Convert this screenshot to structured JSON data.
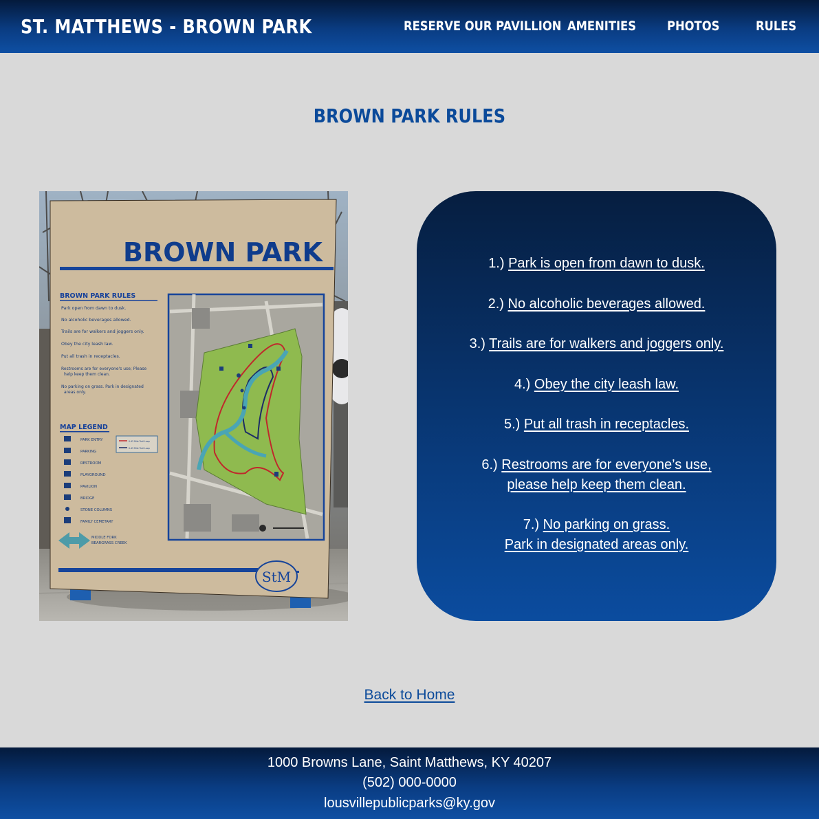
{
  "header": {
    "site_title": "ST. MATTHEWS - BROWN PARK",
    "nav": [
      {
        "label": "RESERVE OUR PAVILLION"
      },
      {
        "label": "AMENITIES"
      },
      {
        "label": "PHOTOS"
      },
      {
        "label": "RULES"
      }
    ]
  },
  "main": {
    "page_title": "BROWN PARK RULES",
    "sign": {
      "title": "BROWN PARK",
      "rules_heading": "BROWN PARK RULES",
      "rules": [
        "Park open from dawn to dusk.",
        "No alcoholic beverages allowed.",
        "Trails are for walkers and joggers only.",
        "Obey the city leash law.",
        "Put all trash in receptacles.",
        "Restrooms are for everyone's use; Please help keep them clean.",
        "No parking on grass. Park in designated areas only."
      ],
      "legend_heading": "MAP LEGEND",
      "legend": [
        "PARK ENTRY",
        "PARKING",
        "RESTROOM",
        "PLAYGROUND",
        "PAVILION",
        "BRIDGE",
        "STONE COLUMNS",
        "FAMILY CEMETARY"
      ],
      "creek_label": "MIDDLE FORK BEARGRASS CREEK",
      "trail_labels": [
        "0.42 Mile Trail Loop",
        "0.45 Mile Trail Loop"
      ],
      "logo": "StM"
    },
    "rules": [
      {
        "number": "1.)",
        "lines": [
          "Park is open from dawn to dusk."
        ]
      },
      {
        "number": "2.)",
        "lines": [
          "No alcoholic beverages allowed."
        ]
      },
      {
        "number": "3.)",
        "lines": [
          "Trails are for walkers and joggers only."
        ]
      },
      {
        "number": "4.)",
        "lines": [
          "Obey the city leash law."
        ]
      },
      {
        "number": "5.)",
        "lines": [
          "Put all trash in receptacles."
        ]
      },
      {
        "number": "6.)",
        "lines": [
          "Restrooms are for everyone’s use,",
          "please help keep them clean."
        ]
      },
      {
        "number": "7.)",
        "lines": [
          "No parking on grass.",
          "Park in designated areas only."
        ]
      }
    ],
    "back_link": "Back to Home"
  },
  "footer": {
    "address": "1000 Browns Lane, Saint Matthews, KY 40207",
    "phone": "(502) 000-0000",
    "email": "lousvillepublicparks@ky.gov"
  },
  "colors": {
    "accent": "#0b4a9a",
    "header_dark": "#041a3c",
    "page_bg": "#d9d9d9",
    "card_top": "#061e40",
    "card_bottom": "#0b4c9f"
  }
}
